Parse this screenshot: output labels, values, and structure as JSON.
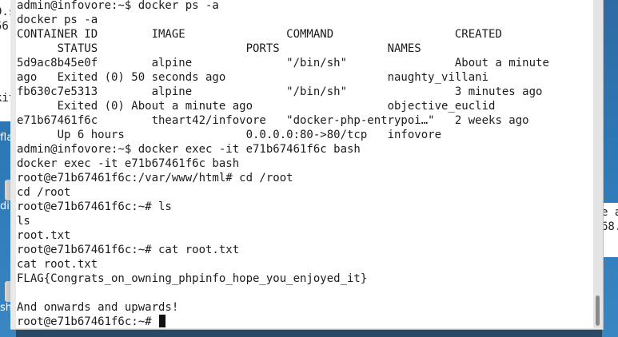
{
  "terminal": {
    "lines": [
      "admin@infovore:~$ docker ps -a",
      "docker ps -a",
      "CONTAINER ID        IMAGE               COMMAND                  CREATED",
      "      STATUS                      PORTS                NAMES",
      "5d9ac8b45e0f        alpine              \"/bin/sh\"                About a minute",
      "ago   Exited (0) 50 seconds ago                        naughty_villani",
      "fb630c7e5313        alpine              \"/bin/sh\"                3 minutes ago",
      "      Exited (0) About a minute ago                    objective_euclid",
      "e71b67461f6c        theart42/infovore   \"docker-php-entrypoi…\"   2 weeks ago",
      "      Up 6 hours                  0.0.0.0:80->80/tcp   infovore",
      "admin@infovore:~$ docker exec -it e71b67461f6c bash",
      "docker exec -it e71b67461f6c bash",
      "root@e71b67461f6c:/var/www/html# cd /root",
      "cd /root",
      "root@e71b67461f6c:~# ls",
      "ls",
      "root.txt",
      "root@e71b67461f6c:~# cat root.txt",
      "cat root.txt",
      "FLAG{Congrats_on_owning_phpinfo_hope_you_enjoyed_it}",
      "",
      "And onwards and upwards!"
    ],
    "prompt": "root@e71b67461f6c:~# "
  },
  "background": {
    "left_window_lines": [
      "D.s",
      "56",
      "",
      "",
      "",
      "",
      "kit"
    ],
    "right_window_lines": [
      "e a",
      "68."
    ],
    "desktop_icons": [
      "fla",
      "dir",
      "sh"
    ]
  },
  "colors": {
    "terminal_bg": "#ffffff",
    "terminal_text": "#1c1c1c",
    "desktop_bg": "#2d78b6",
    "scrollbar_thumb": "#8a8a8a"
  }
}
